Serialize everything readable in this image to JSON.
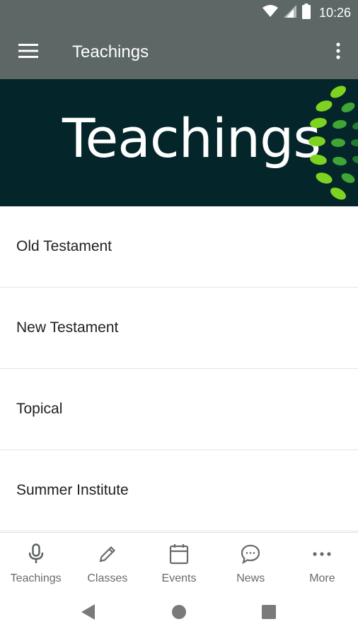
{
  "status_bar": {
    "time": "10:26",
    "icons": [
      "wifi-icon",
      "signal-icon",
      "battery-icon"
    ]
  },
  "app_bar": {
    "title": "Teachings",
    "menu_icon": "hamburger-menu-icon",
    "overflow_icon": "more-vert-icon",
    "background_color": "#5c6766"
  },
  "banner": {
    "title": "Teachings",
    "background_color": "#04262a",
    "accent_color": "#7ed321"
  },
  "list": {
    "items": [
      {
        "label": "Old Testament"
      },
      {
        "label": "New Testament"
      },
      {
        "label": "Topical"
      },
      {
        "label": "Summer Institute"
      }
    ]
  },
  "bottom_nav": {
    "tabs": [
      {
        "label": "Teachings",
        "icon": "microphone-icon"
      },
      {
        "label": "Classes",
        "icon": "pencil-icon"
      },
      {
        "label": "Events",
        "icon": "calendar-icon"
      },
      {
        "label": "News",
        "icon": "chat-bubble-icon"
      },
      {
        "label": "More",
        "icon": "more-horiz-icon"
      }
    ]
  },
  "system_nav": {
    "icons": [
      "back-icon",
      "home-icon",
      "recents-icon"
    ]
  }
}
